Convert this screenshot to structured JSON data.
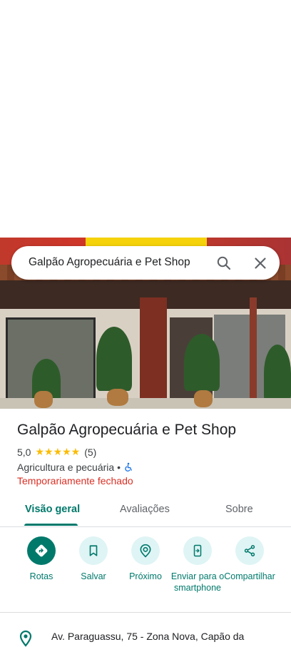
{
  "search": {
    "query": "Galpão Agropecuária e Pet Shop"
  },
  "place": {
    "name": "Galpão Agropecuária e Pet Shop",
    "rating": "5,0",
    "stars": "★★★★★",
    "review_count": "(5)",
    "category": "Agricultura e pecuária •",
    "status": "Temporariamente fechado"
  },
  "tabs": [
    {
      "label": "Visão geral",
      "active": true
    },
    {
      "label": "Avaliações",
      "active": false
    },
    {
      "label": "Sobre",
      "active": false
    }
  ],
  "actions": [
    {
      "label": "Rotas",
      "icon": "directions-icon"
    },
    {
      "label": "Salvar",
      "icon": "bookmark-icon"
    },
    {
      "label": "Próximo",
      "icon": "nearby-icon"
    },
    {
      "label": "Enviar para o smartphone",
      "icon": "send-to-phone-icon"
    },
    {
      "label": "Compartilhar",
      "icon": "share-icon"
    }
  ],
  "address": "Av. Paraguassu, 75 - Zona Nova, Capão da",
  "colors": {
    "accent": "#00796b",
    "accent_light": "#dff4f5",
    "closed": "#d93025",
    "star": "#fbbc04"
  }
}
